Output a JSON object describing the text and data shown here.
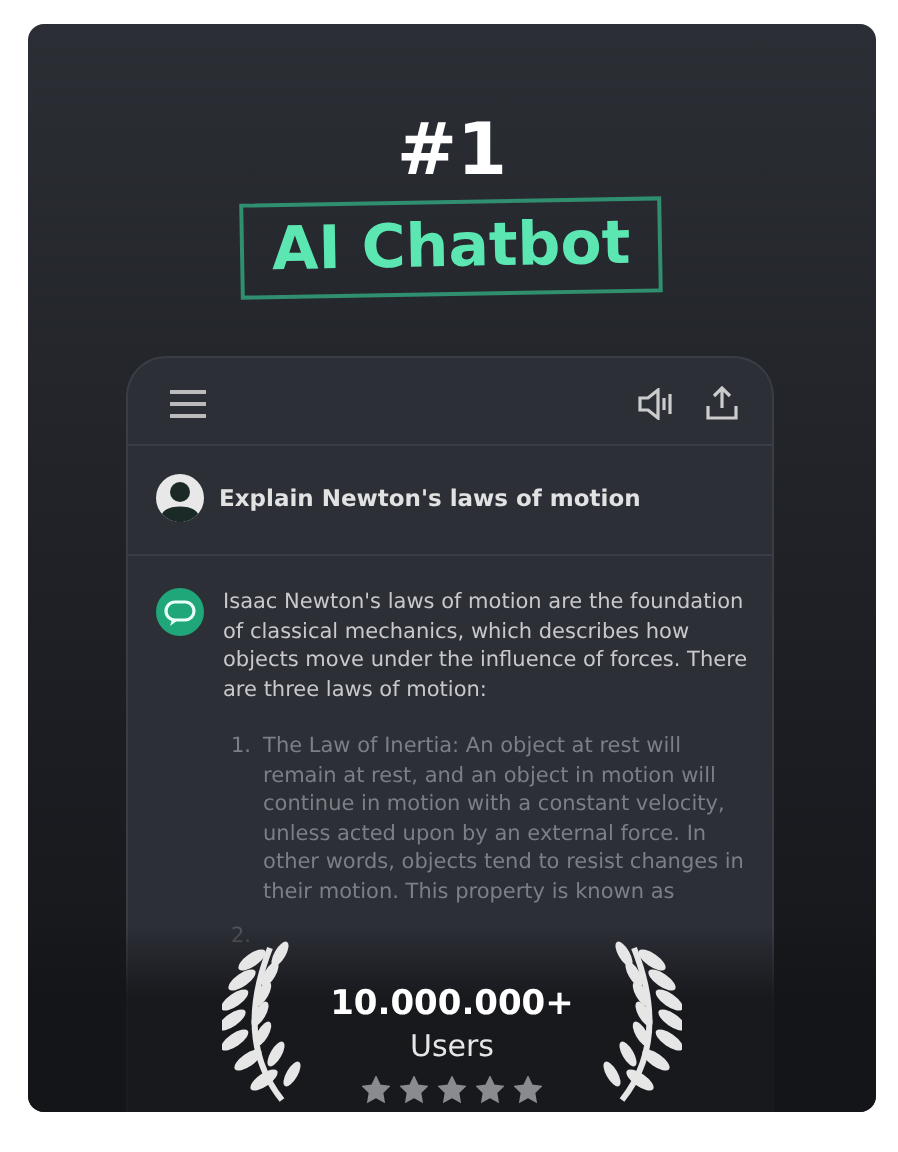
{
  "headline": {
    "rank": "#1",
    "title": "AI Chatbot"
  },
  "chat": {
    "prompt": "Explain Newton's laws of motion",
    "answer": {
      "intro": "Isaac Newton's laws of motion are the foundation of classical mechanics, which describes how objects move under the influence of forces. There are three laws of motion:",
      "items": [
        {
          "number": "1.",
          "text": "The Law of Inertia: An object at rest will remain at rest, and an object in motion will continue in motion with a constant velocity, unless acted upon by an external force. In other words, objects tend to resist changes in their motion. This property is known as"
        },
        {
          "number": "2."
        }
      ]
    }
  },
  "badge": {
    "count": "10.000.000+",
    "label": "Users",
    "stars": 5
  }
}
